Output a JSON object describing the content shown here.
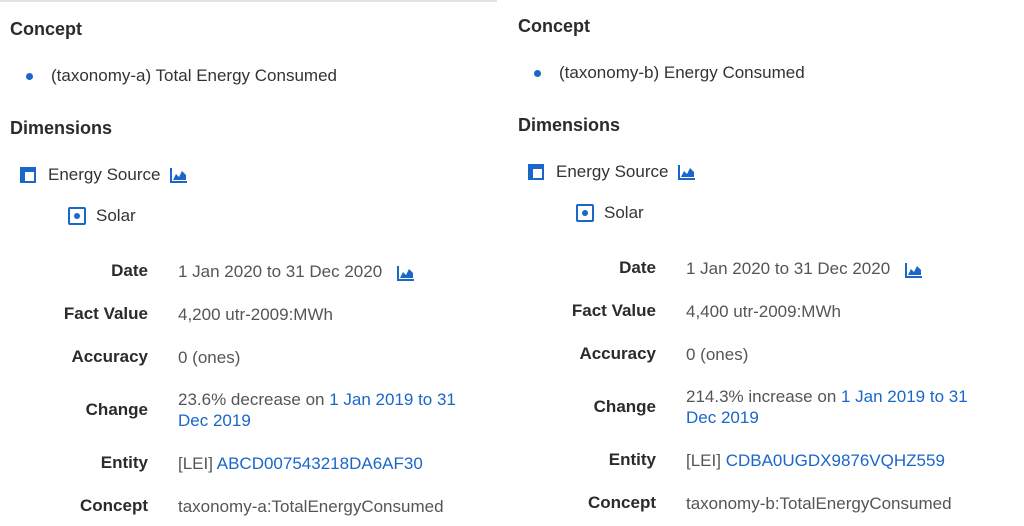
{
  "panels": [
    {
      "concept_heading": "Concept",
      "concept_item": "(taxonomy-a) Total Energy Consumed",
      "dimensions_heading": "Dimensions",
      "dimension_name": "Energy Source",
      "dimension_member": "Solar",
      "facts": {
        "date_label": "Date",
        "date_value": "1 Jan 2020 to 31 Dec 2020",
        "fact_value_label": "Fact Value",
        "fact_value": "4,200 utr-2009:MWh",
        "accuracy_label": "Accuracy",
        "accuracy_value": "0 (ones)",
        "change_label": "Change",
        "change_prefix": "23.6% decrease on ",
        "change_link": "1 Jan 2019 to 31 Dec 2019",
        "entity_label": "Entity",
        "entity_prefix": "[LEI] ",
        "entity_link": "ABCD007543218DA6AF30",
        "concept_label": "Concept",
        "concept_value": "taxonomy-a:TotalEnergyConsumed"
      }
    },
    {
      "concept_heading": "Concept",
      "concept_item": "(taxonomy-b) Energy Consumed",
      "dimensions_heading": "Dimensions",
      "dimension_name": "Energy Source",
      "dimension_member": "Solar",
      "facts": {
        "date_label": "Date",
        "date_value": "1 Jan 2020 to 31 Dec 2020",
        "fact_value_label": "Fact Value",
        "fact_value": "4,400 utr-2009:MWh",
        "accuracy_label": "Accuracy",
        "accuracy_value": "0 (ones)",
        "change_label": "Change",
        "change_prefix": "214.3% increase on ",
        "change_link": "1 Jan 2019 to 31 Dec 2019",
        "entity_label": "Entity",
        "entity_prefix": "[LEI] ",
        "entity_link": "CDBA0UGDX9876VQHZ559",
        "concept_label": "Concept",
        "concept_value": "taxonomy-b:TotalEnergyConsumed"
      }
    }
  ],
  "colors": {
    "accent": "#1a66c9",
    "label": "#2b2b2b",
    "value": "#555555"
  },
  "icons": {
    "dimension": "table-icon",
    "chart": "area-chart-icon",
    "member": "radio-member-icon",
    "bullet": "bullet-icon"
  }
}
